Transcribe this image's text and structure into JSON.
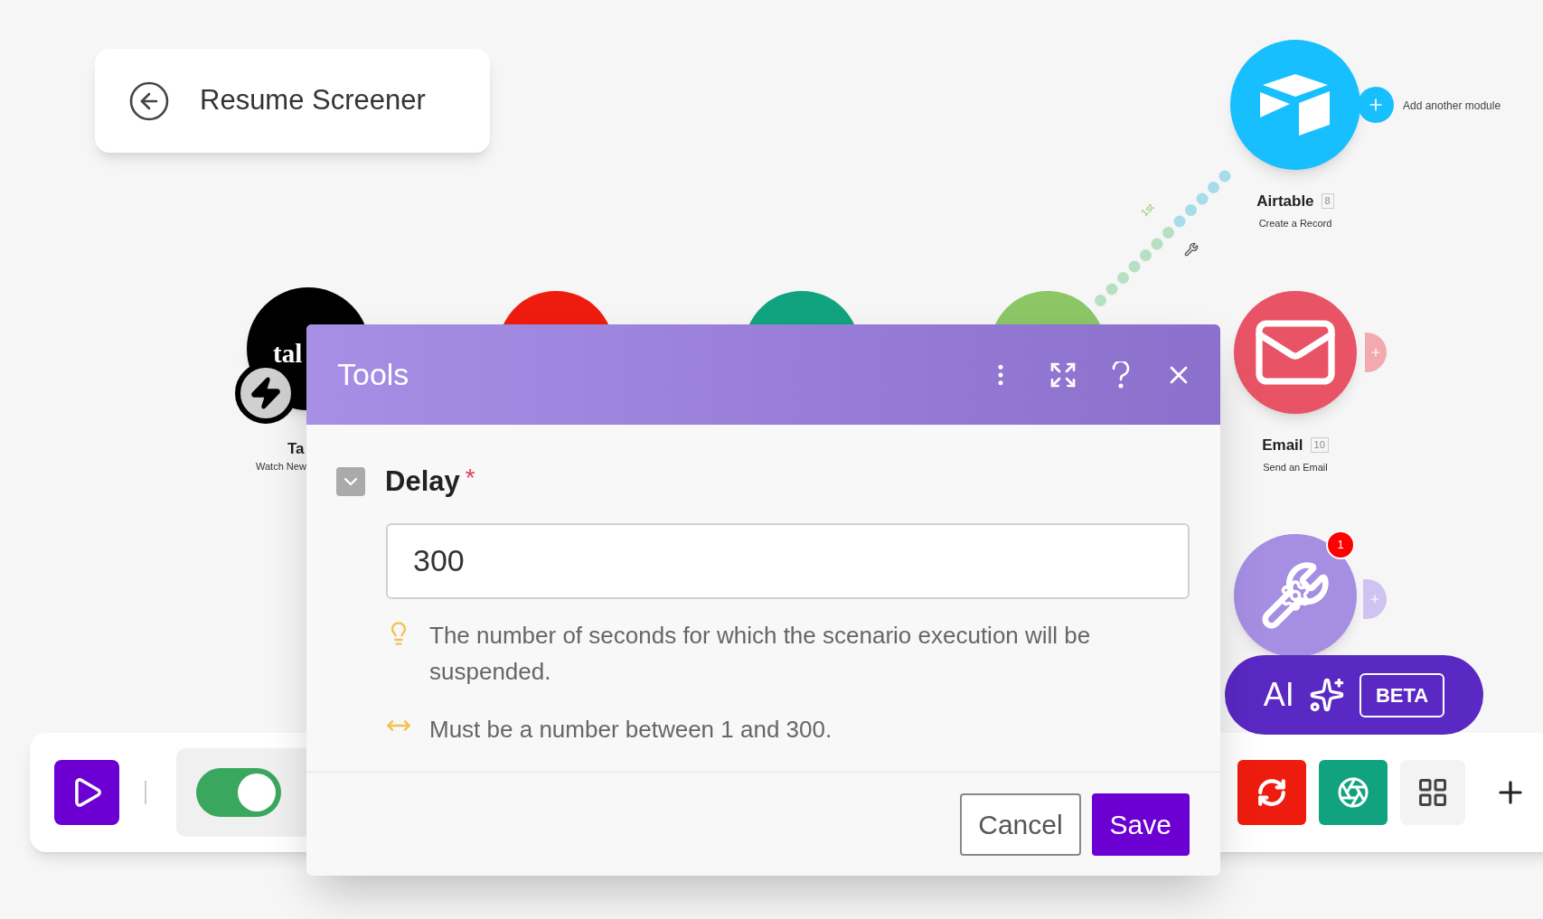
{
  "scenario": {
    "title": "Resume Screener"
  },
  "canvas": {
    "route_label": "1st",
    "nodes": [
      {
        "kind": "tally",
        "logo_text": "tal",
        "label": "Ta",
        "sublabel": "Watch New"
      },
      {
        "kind": "red"
      },
      {
        "kind": "teal"
      },
      {
        "kind": "green"
      },
      {
        "kind": "airtable",
        "label": "Airtable",
        "count": "8",
        "sublabel": "Create a Record",
        "add_label": "Add another module"
      },
      {
        "kind": "email",
        "label": "Email",
        "count": "10",
        "sublabel": "Send an Email"
      },
      {
        "kind": "tools",
        "badge": "1"
      }
    ]
  },
  "ai_button": {
    "label": "AI",
    "badge": "BETA"
  },
  "toolbar": {
    "scheduling": {
      "on": true
    }
  },
  "dialog": {
    "title": "Tools",
    "field": {
      "label": "Delay",
      "required": true,
      "required_mark": "*",
      "expanded": true,
      "value": "300",
      "hints": [
        {
          "kind": "info",
          "text": "The number of seconds for which the scenario execution will be suspended."
        },
        {
          "kind": "range",
          "text": "Must be a number between 1 and 300."
        }
      ]
    },
    "buttons": [
      {
        "kind": "secondary",
        "label": "Cancel"
      },
      {
        "kind": "primary",
        "label": "Save"
      }
    ]
  }
}
